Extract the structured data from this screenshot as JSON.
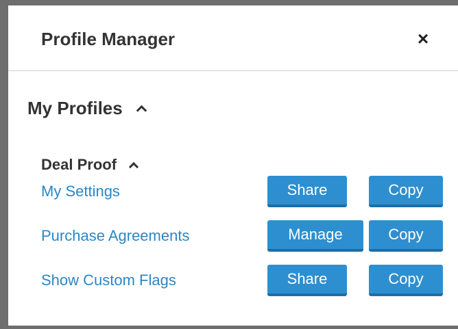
{
  "dialog": {
    "title": "Profile Manager",
    "close_symbol": "×"
  },
  "section": {
    "title": "My Profiles",
    "icon": "chevron-up-icon"
  },
  "group": {
    "title": "Deal Proof",
    "icon": "chevron-up-icon"
  },
  "rows": [
    {
      "label": "My Settings",
      "primary_action": "Share",
      "secondary_action": "Copy"
    },
    {
      "label": "Purchase Agreements",
      "primary_action": "Manage",
      "secondary_action": "Copy"
    },
    {
      "label": "Show Custom Flags",
      "primary_action": "Share",
      "secondary_action": "Copy"
    }
  ],
  "colors": {
    "link": "#2b86c5",
    "button": "#2d8fd0",
    "button_shadow": "#1f6ea4",
    "heading": "#333333",
    "frame": "#6e6e6e"
  }
}
